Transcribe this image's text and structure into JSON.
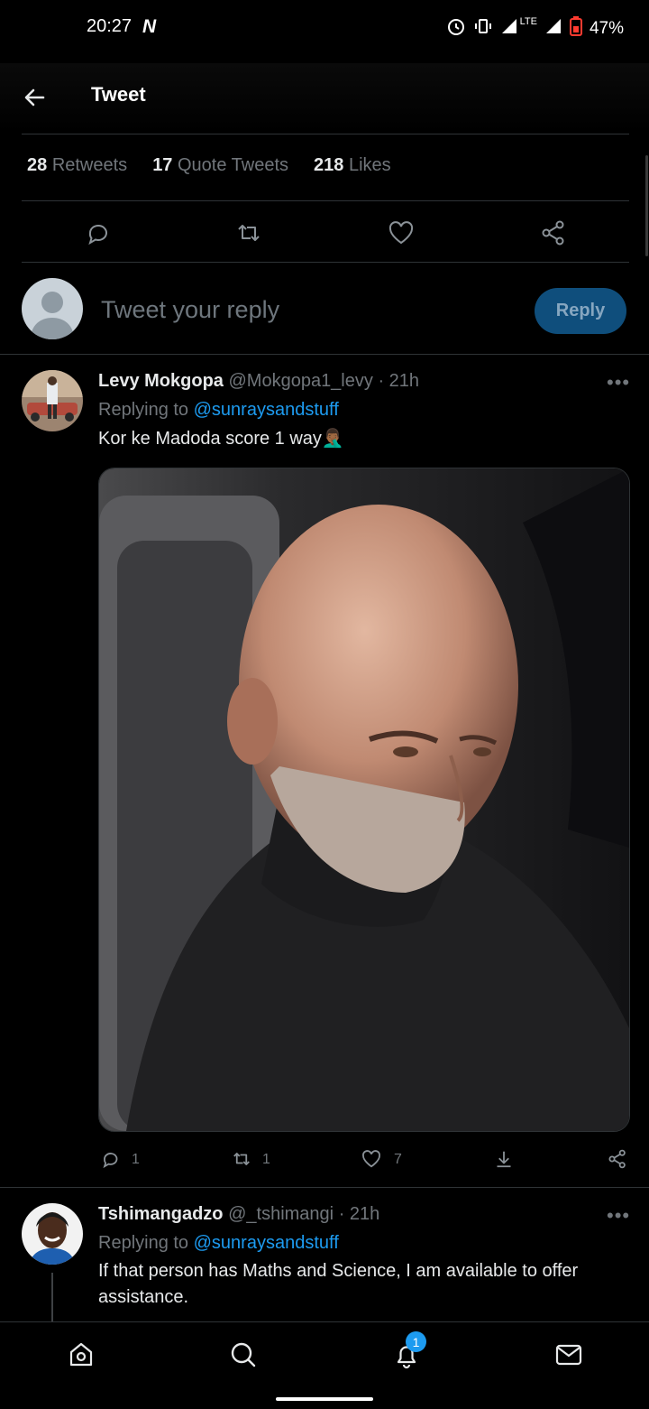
{
  "status_bar": {
    "time": "20:27",
    "carrier_logo": "N",
    "network": "LTE",
    "battery": "47%",
    "icons": [
      "alarm-icon",
      "vibrate-icon",
      "signal-icon",
      "signal-icon-2",
      "battery-icon"
    ]
  },
  "header": {
    "title": "Tweet"
  },
  "stats": {
    "retweets_count": "28",
    "retweets_label": "Retweets",
    "quotes_count": "17",
    "quotes_label": "Quote Tweets",
    "likes_count": "218",
    "likes_label": "Likes"
  },
  "compose": {
    "placeholder": "Tweet your reply",
    "reply_label": "Reply"
  },
  "tweets": [
    {
      "display_name": "Levy Mokgopa",
      "handle": "@Mokgopa1_levy",
      "time": "· 21h",
      "replying_prefix": "Replying to",
      "replying_to": "@sunraysandstuff",
      "text": "Kor ke Madoda score 1 way🤦🏾‍♂️",
      "reply_count": "1",
      "retweet_count": "1",
      "like_count": "7"
    },
    {
      "display_name": "Tshimangadzo",
      "handle": "@_tshimangi",
      "time": "· 21h",
      "replying_prefix": "Replying to",
      "replying_to": "@sunraysandstuff",
      "text_line1": "If that person has Maths and Science, I am available to offer",
      "text_line2": "assistance."
    }
  ],
  "bottom_nav": {
    "notifications_badge": "1"
  },
  "colors": {
    "accent": "#1d9bf0",
    "reply_button_bg": "#0f4e7c",
    "muted_text": "#71767b",
    "divider": "#2f3336"
  }
}
